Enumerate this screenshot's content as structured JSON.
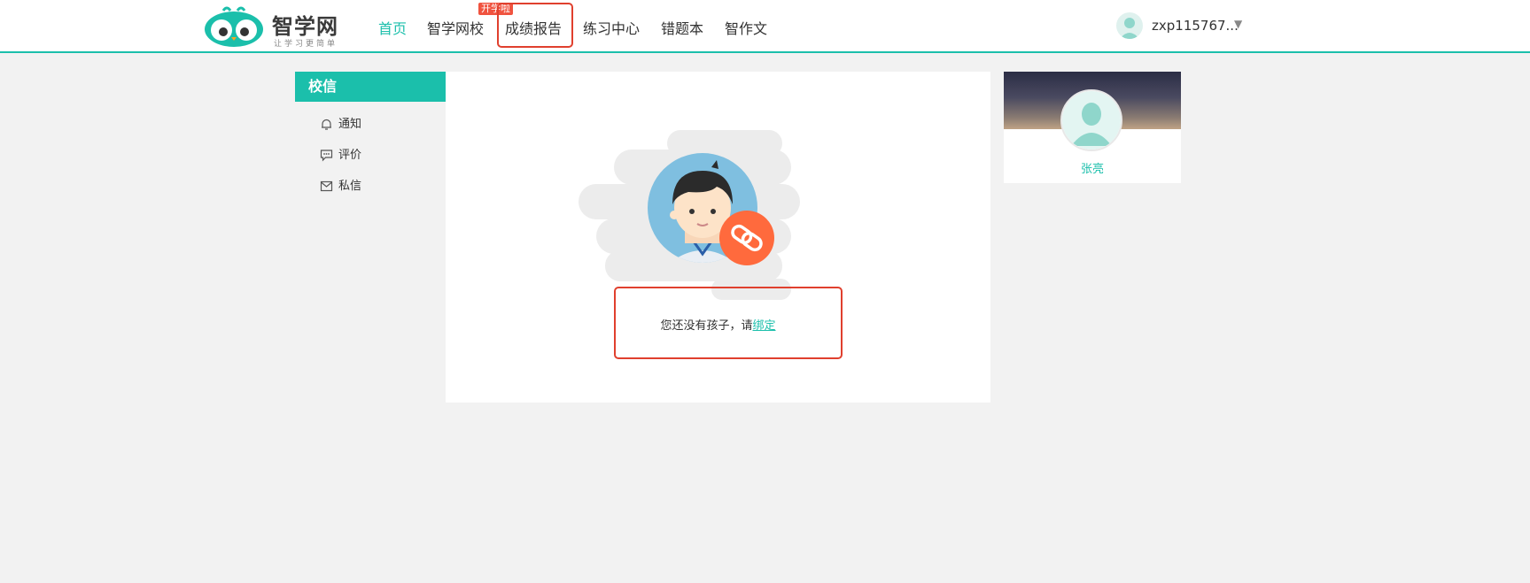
{
  "brand": {
    "name": "智学网",
    "slogan": "让学习更简单",
    "color": "#1bbfab"
  },
  "nav": {
    "items": [
      {
        "label": "首页",
        "active": true
      },
      {
        "label": "智学网校",
        "active": false
      },
      {
        "label": "成绩报告",
        "active": false
      },
      {
        "label": "练习中心",
        "active": false
      },
      {
        "label": "错题本",
        "active": false
      },
      {
        "label": "智作文",
        "active": false
      }
    ],
    "badge": "开学啦"
  },
  "user": {
    "name": "zxp115767...",
    "avatar_icon": "user-avatar-icon",
    "dropdown_icon": "caret-down-icon"
  },
  "sidebar": {
    "title": "校信",
    "items": [
      {
        "label": "通知",
        "icon": "bell-icon"
      },
      {
        "label": "评价",
        "icon": "comment-icon"
      },
      {
        "label": "私信",
        "icon": "mail-icon"
      }
    ]
  },
  "main": {
    "empty_text": "您还没有孩子，请",
    "bind_link": "绑定",
    "illustration_icon": "link-icon"
  },
  "profile": {
    "name": "张亮"
  },
  "colors": {
    "accent": "#1bbfab",
    "highlight": "#e0402e",
    "link_badge": "#ff6a3d"
  }
}
